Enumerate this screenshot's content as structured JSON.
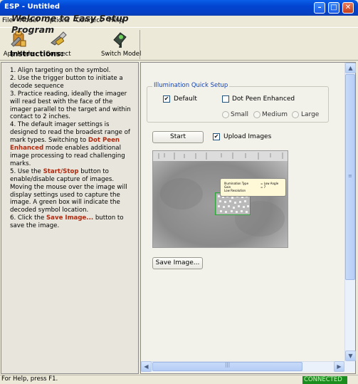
{
  "window": {
    "title": "ESP - Untitled",
    "controls": [
      "minimize-icon",
      "maximize-icon",
      "close-icon"
    ]
  },
  "menu": [
    "File",
    "Model",
    "Options",
    "Connect",
    "Help"
  ],
  "toolbar": {
    "app_mode": "App Mode",
    "connect": "Connect",
    "switch_model": "Switch Model"
  },
  "left": {
    "welcome": "Welcome to Easy Setup Program",
    "instructions_heading": "Instructions:",
    "steps": {
      "s1": "1. Align targeting on the symbol.",
      "s2": "2. Use the trigger button to initiate a decode sequence",
      "s3": "3. Practice reading, ideally the imager will read best with the face of the imager parallel to the target and within contact to 2 inches.",
      "s4a": "4. The default imager settings is designed to read the broadest range of mark types. Switching to ",
      "s4b": "Dot Peen Enhanced",
      "s4c": " mode enables additional image processing to read challenging marks.",
      "s5a": "5. Use the ",
      "s5b": "Start/Stop",
      "s5c": " button to enable/disable capture of images. Moving the mouse over the image will display settings used to capture the image. A green box will indicate the decoded symbol location.",
      "s6a": "6. Click the ",
      "s6b": "Save Image...",
      "s6c": " button to save the image."
    }
  },
  "quick_setup": {
    "group_title": "Illumination Quick Setup",
    "default_label": "Default",
    "default_checked": true,
    "dot_peen_label": "Dot Peen Enhanced",
    "dot_peen_checked": false,
    "sizes": [
      "Small",
      "Medium",
      "Large"
    ]
  },
  "actions": {
    "start": "Start",
    "upload_images": "Upload Images",
    "upload_checked": true,
    "save_image": "Save Image..."
  },
  "image_tooltip": {
    "line1_k": "Illumination Type",
    "line1_v": "= Low Angle",
    "line2_k": "Gain",
    "line2_v": "= 7",
    "line3_k": "Low Resolution"
  },
  "status": {
    "help": "For Help, press F1.",
    "connection": "CONNECTED"
  },
  "colors": {
    "title_bar": "#0244d0",
    "connected_bg": "#1a8d1e",
    "highlight": "#b12a10",
    "group_title": "#1844b4",
    "decode_box": "#2ea83a"
  }
}
